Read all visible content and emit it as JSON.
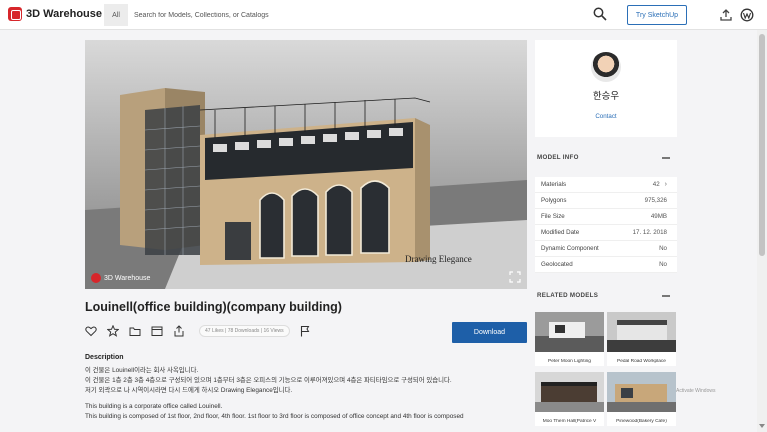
{
  "brand": {
    "name": "3D Warehouse",
    "accent": "#d7262b",
    "link": "#2b6fb7",
    "primary": "#1e5fa8"
  },
  "search": {
    "scope": "All",
    "placeholder": "Search for Models, Collections, or Catalogs"
  },
  "header": {
    "try_label": "Try SketchUp"
  },
  "viewer": {
    "watermark": "3D Warehouse"
  },
  "model": {
    "title": "Louinell(office building)(company building)",
    "stats": "47 Likes | 78 Downloads | 16 Views",
    "download_label": "Download",
    "description_heading": "Description",
    "description": [
      "이 건물은 Louinell이라는 회사 사옥입니다.",
      "이 건물은 1층 2층 3층 4층으로 구성되어 있으며 1층부터 3층은 오피스의 기능으로 이루어져있으며 4층은 파티타임으로 구성되어 있습니다.",
      "저기 외곽으로 나 시역이시라면 다시 드에게 하시오 Drawing Elegance입니다.",
      "",
      "This building is a corporate office called Louinell.",
      "This building is composed of 1st floor, 2nd floor, 4th floor. 1st floor to 3rd floor is composed of office concept and 4th floor is composed"
    ]
  },
  "author": {
    "name": "한승우",
    "contact_label": "Contact"
  },
  "model_info": {
    "heading": "MODEL INFO",
    "rows": [
      {
        "label": "Materials",
        "value": "42"
      },
      {
        "label": "Polygons",
        "value": "975,326"
      },
      {
        "label": "File Size",
        "value": "49MB"
      },
      {
        "label": "Modified Date",
        "value": "17. 12. 2018"
      },
      {
        "label": "Dynamic Component",
        "value": "No"
      },
      {
        "label": "Geolocated",
        "value": "No"
      }
    ]
  },
  "related": {
    "heading": "RELATED MODELS",
    "items": [
      {
        "title": "Peter Moon Lighting"
      },
      {
        "title": "Pedal Road Workplace"
      },
      {
        "title": "Moo Them Hall(Patrice V"
      },
      {
        "title": "Pinewood(Bakery Cafe)"
      }
    ]
  },
  "system_note": "Activate Windows"
}
